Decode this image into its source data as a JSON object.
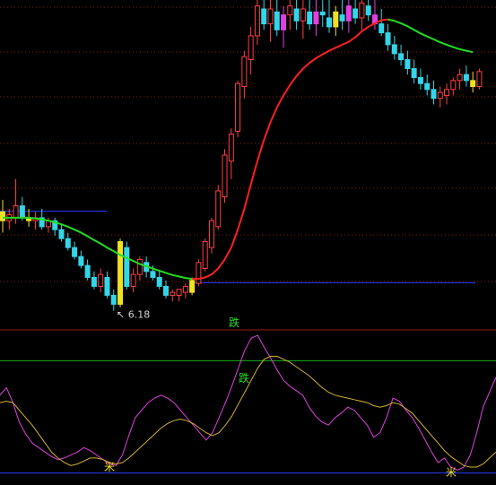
{
  "colors": {
    "background": "#000000",
    "grid": "#8b1a1a",
    "separator": "#9a1a1a",
    "upper_hline": "#2a3bff",
    "lower_hline": "#2a3bff",
    "green_hline": "#19b319",
    "ma_rising": "#ff2020",
    "ma_falling": "#22dd22",
    "candle_up": "#ff4040",
    "candle_down": "#33d6e8",
    "candle_yellow": "#f0e020",
    "candle_magenta": "#e040e0",
    "osc_fast": "#e040e0",
    "osc_slow": "#d4b030",
    "marker_text": "#d8d8d8",
    "signal_text": "#22dd22",
    "star": "#f0e020"
  },
  "annotations": {
    "low_price_label": "6.18",
    "sell_signal_top": "跌",
    "sell_signal_osc": "跌",
    "buy_signal_1": "米",
    "buy_signal_2": "米"
  },
  "chart_data": [
    {
      "type": "candlestick",
      "title": "",
      "ylim": [
        5.6,
        16.6
      ],
      "low_point": {
        "label": "6.18",
        "value": 6.18
      },
      "hlines": [
        {
          "name": "support",
          "value": 7.12
        },
        {
          "name": "prior-high",
          "value": 9.52
        }
      ],
      "candles": [
        {
          "o": 9.5,
          "h": 9.9,
          "l": 8.8,
          "c": 9.2
        },
        {
          "o": 9.2,
          "h": 9.6,
          "l": 8.9,
          "c": 9.4
        },
        {
          "o": 9.3,
          "h": 10.6,
          "l": 9.1,
          "c": 9.7
        },
        {
          "o": 9.7,
          "h": 10.0,
          "l": 9.2,
          "c": 9.3
        },
        {
          "o": 9.3,
          "h": 9.6,
          "l": 9.0,
          "c": 9.2
        },
        {
          "o": 9.2,
          "h": 9.5,
          "l": 8.9,
          "c": 9.3
        },
        {
          "o": 9.3,
          "h": 9.6,
          "l": 8.9,
          "c": 9.0
        },
        {
          "o": 9.0,
          "h": 9.3,
          "l": 8.8,
          "c": 9.2
        },
        {
          "o": 9.2,
          "h": 9.3,
          "l": 8.7,
          "c": 8.9
        },
        {
          "o": 8.9,
          "h": 9.1,
          "l": 8.5,
          "c": 8.6
        },
        {
          "o": 8.6,
          "h": 8.8,
          "l": 8.2,
          "c": 8.3
        },
        {
          "o": 8.3,
          "h": 8.5,
          "l": 7.9,
          "c": 8.0
        },
        {
          "o": 8.0,
          "h": 8.2,
          "l": 7.6,
          "c": 7.7
        },
        {
          "o": 7.7,
          "h": 7.9,
          "l": 7.2,
          "c": 7.3
        },
        {
          "o": 7.3,
          "h": 7.5,
          "l": 6.9,
          "c": 7.0
        },
        {
          "o": 7.0,
          "h": 7.6,
          "l": 6.8,
          "c": 7.4
        },
        {
          "o": 7.3,
          "h": 7.5,
          "l": 6.6,
          "c": 6.7
        },
        {
          "o": 6.7,
          "h": 6.9,
          "l": 6.18,
          "c": 6.4
        },
        {
          "o": 6.4,
          "h": 8.6,
          "l": 6.3,
          "c": 8.5
        },
        {
          "o": 8.3,
          "h": 8.5,
          "l": 6.9,
          "c": 7.0
        },
        {
          "o": 7.0,
          "h": 7.6,
          "l": 6.8,
          "c": 7.4
        },
        {
          "o": 7.4,
          "h": 8.0,
          "l": 7.2,
          "c": 7.9
        },
        {
          "o": 7.8,
          "h": 8.0,
          "l": 7.3,
          "c": 7.5
        },
        {
          "o": 7.5,
          "h": 7.7,
          "l": 7.2,
          "c": 7.3
        },
        {
          "o": 7.3,
          "h": 7.5,
          "l": 6.9,
          "c": 7.0
        },
        {
          "o": 7.0,
          "h": 7.2,
          "l": 6.6,
          "c": 6.7
        },
        {
          "o": 6.7,
          "h": 6.9,
          "l": 6.5,
          "c": 6.8
        },
        {
          "o": 6.7,
          "h": 6.9,
          "l": 6.5,
          "c": 6.9
        },
        {
          "o": 6.8,
          "h": 7.1,
          "l": 6.6,
          "c": 7.0
        },
        {
          "o": 6.8,
          "h": 7.3,
          "l": 6.7,
          "c": 7.2
        },
        {
          "o": 7.1,
          "h": 7.9,
          "l": 7.0,
          "c": 7.8
        },
        {
          "o": 7.6,
          "h": 8.6,
          "l": 7.5,
          "c": 8.5
        },
        {
          "o": 8.3,
          "h": 9.3,
          "l": 8.1,
          "c": 9.2
        },
        {
          "o": 9.0,
          "h": 10.4,
          "l": 8.9,
          "c": 10.2
        },
        {
          "o": 10.0,
          "h": 11.6,
          "l": 9.8,
          "c": 11.4
        },
        {
          "o": 11.2,
          "h": 12.3,
          "l": 10.6,
          "c": 12.1
        },
        {
          "o": 12.2,
          "h": 13.9,
          "l": 12.0,
          "c": 13.8
        },
        {
          "o": 13.7,
          "h": 14.9,
          "l": 13.3,
          "c": 14.7
        },
        {
          "o": 14.6,
          "h": 15.7,
          "l": 14.1,
          "c": 15.4
        },
        {
          "o": 15.4,
          "h": 16.6,
          "l": 15.1,
          "c": 16.4
        },
        {
          "o": 16.3,
          "h": 16.6,
          "l": 15.6,
          "c": 15.8
        },
        {
          "o": 15.8,
          "h": 16.6,
          "l": 15.2,
          "c": 16.3
        },
        {
          "o": 16.2,
          "h": 16.6,
          "l": 15.4,
          "c": 15.6
        },
        {
          "o": 15.6,
          "h": 16.4,
          "l": 15.0,
          "c": 16.1
        },
        {
          "o": 16.1,
          "h": 16.6,
          "l": 15.6,
          "c": 16.4
        },
        {
          "o": 16.3,
          "h": 16.6,
          "l": 15.6,
          "c": 15.9
        },
        {
          "o": 15.9,
          "h": 16.6,
          "l": 15.3,
          "c": 16.3
        },
        {
          "o": 16.2,
          "h": 16.6,
          "l": 15.6,
          "c": 15.8
        },
        {
          "o": 15.8,
          "h": 16.6,
          "l": 15.4,
          "c": 16.2
        },
        {
          "o": 16.2,
          "h": 16.6,
          "l": 15.7,
          "c": 16.1
        },
        {
          "o": 16.0,
          "h": 16.6,
          "l": 15.5,
          "c": 15.7
        },
        {
          "o": 15.7,
          "h": 16.4,
          "l": 15.4,
          "c": 16.2
        },
        {
          "o": 16.1,
          "h": 16.6,
          "l": 15.6,
          "c": 15.9
        },
        {
          "o": 15.9,
          "h": 16.6,
          "l": 15.5,
          "c": 16.4
        },
        {
          "o": 16.3,
          "h": 16.6,
          "l": 15.8,
          "c": 16.0
        },
        {
          "o": 16.0,
          "h": 16.6,
          "l": 15.6,
          "c": 16.5
        },
        {
          "o": 16.4,
          "h": 16.6,
          "l": 15.9,
          "c": 16.1
        },
        {
          "o": 16.1,
          "h": 16.6,
          "l": 15.6,
          "c": 15.8
        },
        {
          "o": 15.8,
          "h": 16.3,
          "l": 15.4,
          "c": 15.5
        },
        {
          "o": 15.5,
          "h": 15.8,
          "l": 14.9,
          "c": 15.1
        },
        {
          "o": 15.1,
          "h": 15.4,
          "l": 14.6,
          "c": 14.8
        },
        {
          "o": 14.8,
          "h": 15.1,
          "l": 14.4,
          "c": 14.6
        },
        {
          "o": 14.6,
          "h": 14.9,
          "l": 14.1,
          "c": 14.3
        },
        {
          "o": 14.3,
          "h": 14.6,
          "l": 13.8,
          "c": 14.0
        },
        {
          "o": 14.0,
          "h": 14.3,
          "l": 13.6,
          "c": 13.8
        },
        {
          "o": 13.8,
          "h": 14.1,
          "l": 13.4,
          "c": 13.6
        },
        {
          "o": 13.6,
          "h": 13.9,
          "l": 13.1,
          "c": 13.3
        },
        {
          "o": 13.3,
          "h": 13.7,
          "l": 13.0,
          "c": 13.5
        },
        {
          "o": 13.4,
          "h": 13.8,
          "l": 13.1,
          "c": 13.6
        },
        {
          "o": 13.6,
          "h": 14.0,
          "l": 13.4,
          "c": 13.9
        },
        {
          "o": 13.9,
          "h": 14.3,
          "l": 13.6,
          "c": 14.1
        },
        {
          "o": 14.1,
          "h": 14.4,
          "l": 13.7,
          "c": 13.9
        },
        {
          "o": 13.9,
          "h": 14.2,
          "l": 13.5,
          "c": 13.7
        },
        {
          "o": 13.7,
          "h": 14.3,
          "l": 13.6,
          "c": 14.2
        }
      ],
      "highlight": {
        "yellow": [
          0,
          4,
          18,
          29,
          51,
          72
        ],
        "magenta": [
          43,
          48,
          53,
          57
        ]
      },
      "ma": [
        9.3,
        9.3,
        9.3,
        9.3,
        9.3,
        9.28,
        9.25,
        9.2,
        9.15,
        9.08,
        9.0,
        8.9,
        8.8,
        8.68,
        8.55,
        8.43,
        8.3,
        8.18,
        8.05,
        7.95,
        7.85,
        7.75,
        7.67,
        7.6,
        7.52,
        7.45,
        7.38,
        7.33,
        7.28,
        7.25,
        7.25,
        7.3,
        7.4,
        7.6,
        7.9,
        8.3,
        8.9,
        9.6,
        10.4,
        11.2,
        11.9,
        12.5,
        13.0,
        13.4,
        13.75,
        14.05,
        14.3,
        14.5,
        14.65,
        14.78,
        14.9,
        15.0,
        15.1,
        15.2,
        15.35,
        15.55,
        15.7,
        15.82,
        15.92,
        15.95,
        15.9,
        15.82,
        15.72,
        15.6,
        15.48,
        15.38,
        15.28,
        15.18,
        15.1,
        15.02,
        14.95,
        14.9,
        14.85
      ],
      "ma_turn_index": 29,
      "ma_peak_index": 59
    },
    {
      "type": "line",
      "title": "",
      "ylim": [
        0,
        100
      ],
      "hlines": [
        {
          "name": "upper",
          "value": 83
        },
        {
          "name": "lower",
          "value": 8
        }
      ],
      "series": [
        {
          "key": "fast",
          "values": [
            60,
            65,
            55,
            42,
            34,
            28,
            25,
            22,
            19,
            17,
            18,
            20,
            22,
            25,
            23,
            20,
            17,
            14,
            13,
            20,
            33,
            45,
            50,
            55,
            58,
            60,
            58,
            55,
            50,
            45,
            40,
            35,
            30,
            35,
            45,
            55,
            66,
            78,
            90,
            98,
            100,
            92,
            85,
            77,
            70,
            66,
            63,
            60,
            52,
            46,
            42,
            40,
            45,
            48,
            52,
            50,
            45,
            40,
            32,
            35,
            45,
            58,
            56,
            50,
            45,
            38,
            30,
            22,
            15,
            18,
            12,
            10,
            12,
            20,
            35,
            52,
            62,
            72
          ]
        },
        {
          "key": "slow",
          "values": [
            55,
            56,
            55,
            50,
            45,
            40,
            34,
            28,
            22,
            18,
            15,
            13,
            14,
            16,
            18,
            18,
            17,
            15,
            14,
            15,
            18,
            22,
            26,
            30,
            34,
            38,
            41,
            43,
            44,
            43,
            41,
            38,
            35,
            33,
            35,
            40,
            46,
            54,
            62,
            70,
            78,
            84,
            86,
            86,
            84,
            82,
            79,
            76,
            73,
            69,
            65,
            62,
            60,
            59,
            58,
            57,
            56,
            55,
            53,
            52,
            53,
            55,
            54,
            51,
            48,
            43,
            38,
            33,
            28,
            23,
            19,
            16,
            13,
            12,
            12,
            14,
            18,
            22
          ]
        }
      ]
    }
  ]
}
